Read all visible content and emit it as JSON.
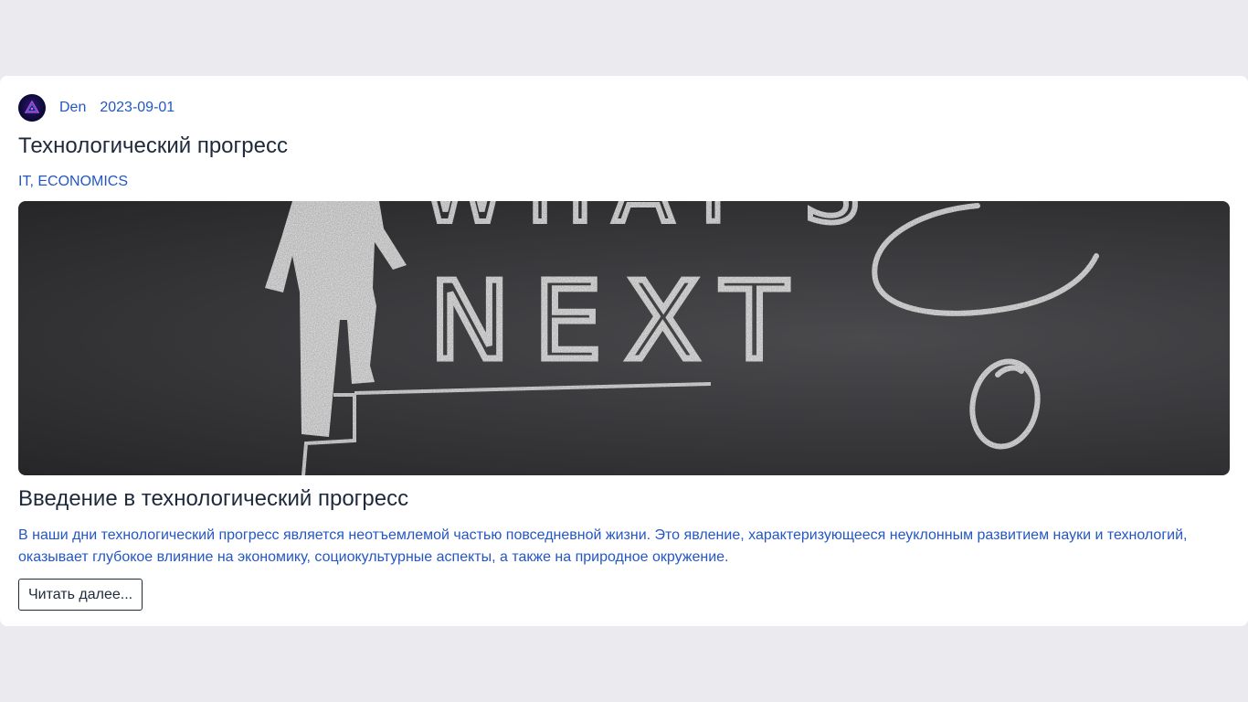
{
  "post": {
    "author": "Den",
    "date": "2023-09-01",
    "title": "Технологический прогресс",
    "tags": "IT, ECONOMICS",
    "image": {
      "chalk_words": [
        "WHAT'S",
        "NEXT"
      ]
    },
    "subtitle": "Введение в технологический прогресс",
    "excerpt": "В наши дни технологический прогресс является неотъемлемой частью повседневной жизни. Это явление, характеризующееся неуклонным развитием науки и технологий, оказывает глубокое влияние на экономику, социокультурные аспекты, а также на природное окружение.",
    "read_more_label": "Читать далее..."
  },
  "colors": {
    "page_bg": "#eaeaef",
    "card_bg": "#ffffff",
    "link": "#2457c5",
    "heading": "#1e2a3b",
    "chalkboard": "#3a3a3d"
  }
}
